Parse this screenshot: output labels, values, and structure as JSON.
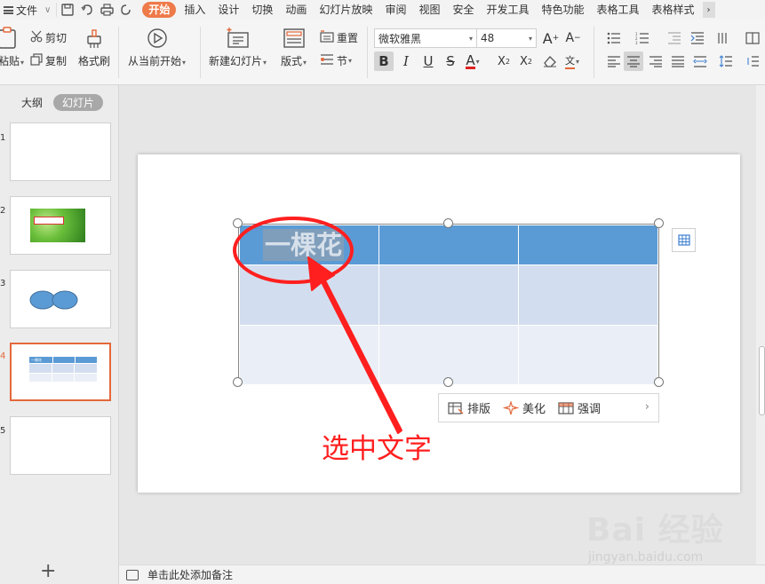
{
  "menubar": {
    "file_label": "文件",
    "tabs": [
      "开始",
      "插入",
      "设计",
      "切换",
      "动画",
      "幻灯片放映",
      "审阅",
      "视图",
      "安全",
      "开发工具",
      "特色功能",
      "表格工具",
      "表格样式"
    ],
    "active_tab": "开始"
  },
  "ribbon": {
    "paste_label": "粘贴",
    "cut_label": "剪切",
    "copy_label": "复制",
    "format_painter_label": "格式刷",
    "from_current_label": "从当前开始",
    "new_slide_label": "新建幻灯片",
    "layout_label": "版式",
    "reset_label": "重置",
    "section_label": "节",
    "font_name": "微软雅黑",
    "font_size": "48"
  },
  "leftpane": {
    "outline_label": "大纲",
    "slides_label": "幻灯片",
    "slide_numbers": [
      "1",
      "2",
      "3",
      "4",
      "5"
    ],
    "active_slide": "4",
    "thumb4_text": "一棵花"
  },
  "slide": {
    "cell_text": "一棵花"
  },
  "floatbar": {
    "layout_label": "排版",
    "beautify_label": "美化",
    "emphasis_label": "强调"
  },
  "annotation": {
    "text": "选中文字",
    "color": "#ff1f1f"
  },
  "notes": {
    "placeholder": "单击此处添加备注"
  },
  "watermark": {
    "main": "Bai 经验",
    "sub": "jingyan.baidu.com"
  },
  "colors": {
    "accent": "#ee7a4a",
    "table_header": "#5b9bd5",
    "table_row1": "#d2deef",
    "table_row2": "#eaeff7"
  }
}
